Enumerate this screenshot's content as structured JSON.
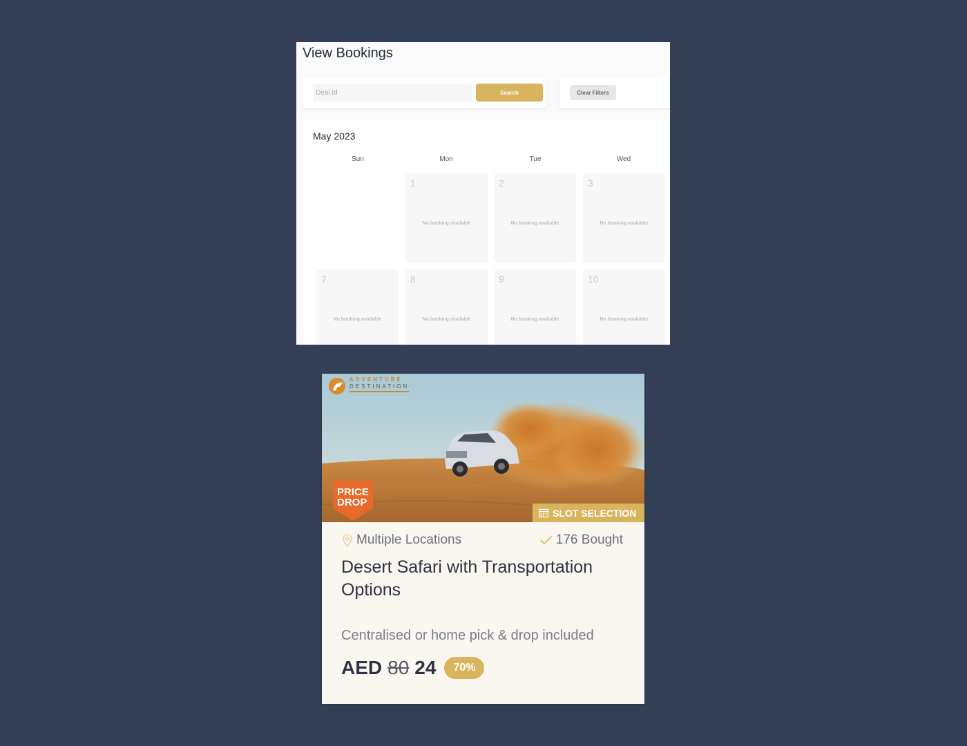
{
  "bookings": {
    "title": "View Bookings",
    "deal_id_placeholder": "Deal Id",
    "search_label": "Search",
    "clear_filters_label": "Clear Filters",
    "month": "May 2023",
    "weekdays": [
      "Sun",
      "Mon",
      "Tue",
      "Wed"
    ],
    "no_booking_text": "No booking available",
    "days": [
      {
        "day": "1",
        "note": "No booking available"
      },
      {
        "day": "2",
        "note": "No booking available"
      },
      {
        "day": "3",
        "note": "No booking available"
      },
      {
        "day": "7",
        "note": "No booking available"
      },
      {
        "day": "8",
        "note": "No booking available"
      },
      {
        "day": "9",
        "note": "No booking available"
      },
      {
        "day": "10",
        "note": "No booking available"
      }
    ]
  },
  "deal": {
    "logo_text": [
      "ADVENTURE",
      "DESTINATION"
    ],
    "badge_price_drop": [
      "PRICE",
      "DROP"
    ],
    "slot_selection_label": "SLOT SELECTION",
    "location": "Multiple Locations",
    "bought": "176 Bought",
    "title": "Desert Safari with Transportation Options",
    "subtitle": "Centralised or home pick & drop included",
    "currency": "AED",
    "old_price": "80",
    "new_price": "24",
    "discount": "70%"
  },
  "colors": {
    "background": "#333f57",
    "accent_gold": "#d9b45f",
    "price_drop_orange": "#e8692a"
  }
}
